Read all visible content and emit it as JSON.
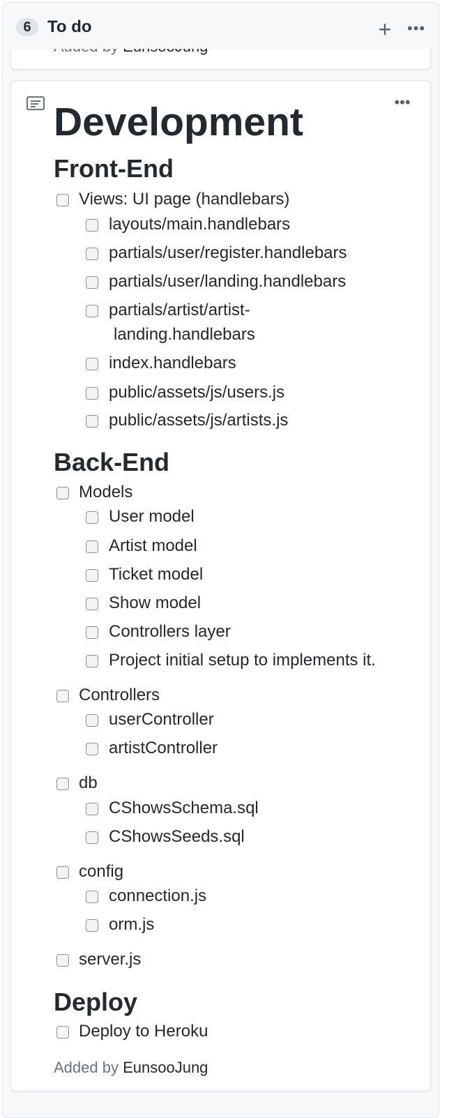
{
  "column": {
    "count": "6",
    "title": "To do",
    "add_icon": "plus-icon",
    "menu_icon": "kebab-icon"
  },
  "prev_card": {
    "added_by_label": "Added by",
    "added_by_user": "EunsooJung"
  },
  "card": {
    "heading": "Development",
    "sections": {
      "frontend": {
        "title": "Front-End",
        "task": "Views: UI page (handlebars)",
        "subtasks": [
          "layouts/main.handlebars",
          "partials/user/register.handlebars",
          "partials/user/landing.handlebars",
          "partials/artist/artist-",
          "landing.handlebars",
          "index.handlebars",
          "public/assets/js/users.js",
          "public/assets/js/artists.js"
        ]
      },
      "backend": {
        "title": "Back-End",
        "models": {
          "label": "Models",
          "subtasks": [
            "User model",
            "Artist model",
            "Ticket model",
            "Show model",
            "Controllers layer",
            "Project initial setup to implements it."
          ]
        },
        "controllers": {
          "label": "Controllers",
          "subtasks": [
            "userController",
            "artistController"
          ]
        },
        "db": {
          "label": "db",
          "subtasks": [
            "CShowsSchema.sql",
            "CShowsSeeds.sql"
          ]
        },
        "config": {
          "label": "config",
          "subtasks": [
            "connection.js",
            "orm.js"
          ]
        },
        "server": {
          "label": "server.js"
        }
      },
      "deploy": {
        "title": "Deploy",
        "task": "Deploy to Heroku"
      }
    },
    "footer": {
      "added_by_label": "Added by",
      "added_by_user": "EunsooJung"
    }
  },
  "colors": {
    "text": "#24292e",
    "muted": "#6a737d",
    "column_bg": "#f6f8fa",
    "border": "#e1e4e8"
  }
}
